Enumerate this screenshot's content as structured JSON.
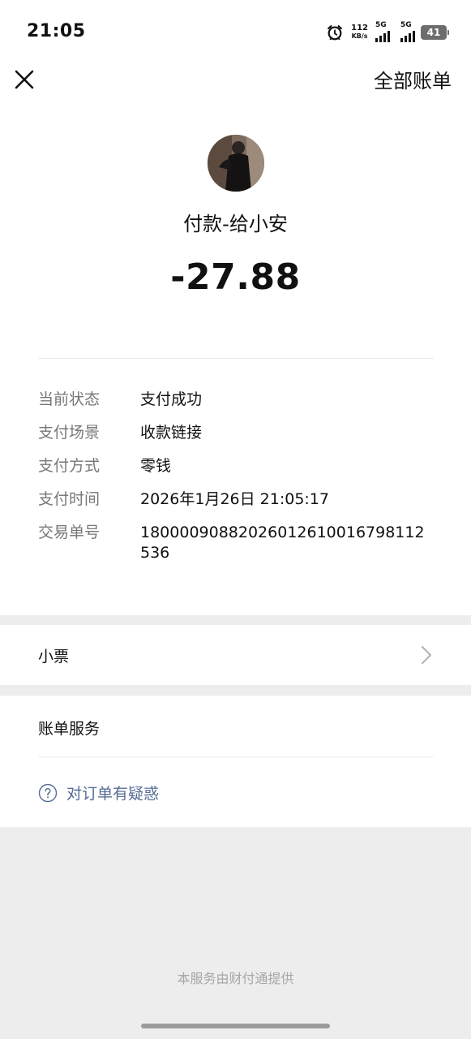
{
  "status_bar": {
    "time": "21:05",
    "net_speed": "112",
    "net_unit": "KB/s",
    "sim1": "5G",
    "sim2": "5G",
    "battery": "41",
    "icons": [
      "alarm-icon",
      "signal-icon",
      "signal-icon",
      "battery-icon"
    ]
  },
  "header": {
    "close_icon": "close-icon",
    "all_bills_label": "全部账单"
  },
  "transaction": {
    "payee": "付款-给小安",
    "amount": "-27.88",
    "details": [
      {
        "label": "当前状态",
        "value": "支付成功"
      },
      {
        "label": "支付场景",
        "value": "收款链接"
      },
      {
        "label": "支付方式",
        "value": "零钱"
      },
      {
        "label": "支付时间",
        "value": "2026年1月26日 21:05:17"
      },
      {
        "label": "交易单号",
        "value": "18000090882026012610016798112536"
      }
    ]
  },
  "receipt": {
    "label": "小票",
    "icon": "chevron-right-icon"
  },
  "bill_service": {
    "title": "账单服务",
    "question_link": "对订单有疑惑",
    "icon": "question-circle-icon",
    "link_color": "#576b95"
  },
  "footer": {
    "provider_text": "本服务由财付通提供"
  }
}
